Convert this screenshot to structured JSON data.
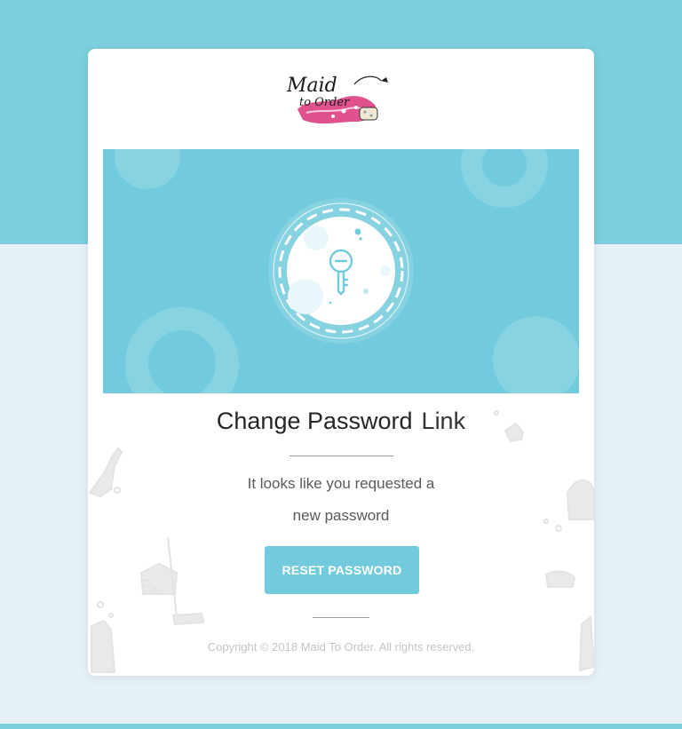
{
  "brand": {
    "logo_text_line1": "Maid",
    "logo_text_line2": "to Order"
  },
  "hero": {
    "icon": "key-icon"
  },
  "heading": {
    "part1": "Change Password",
    "part2": "Link"
  },
  "message": {
    "line1": "It looks like you requested a",
    "line2": "new password"
  },
  "button": {
    "label": "RESET PASSWORD"
  },
  "footer": {
    "copyright": "Copyright © 2018 Maid To Order. All rights reserved."
  },
  "colors": {
    "accent": "#72cbdc",
    "top_band": "#7ccfde",
    "page_bg": "#e6f1f8",
    "logo_pink": "#e0528e"
  }
}
